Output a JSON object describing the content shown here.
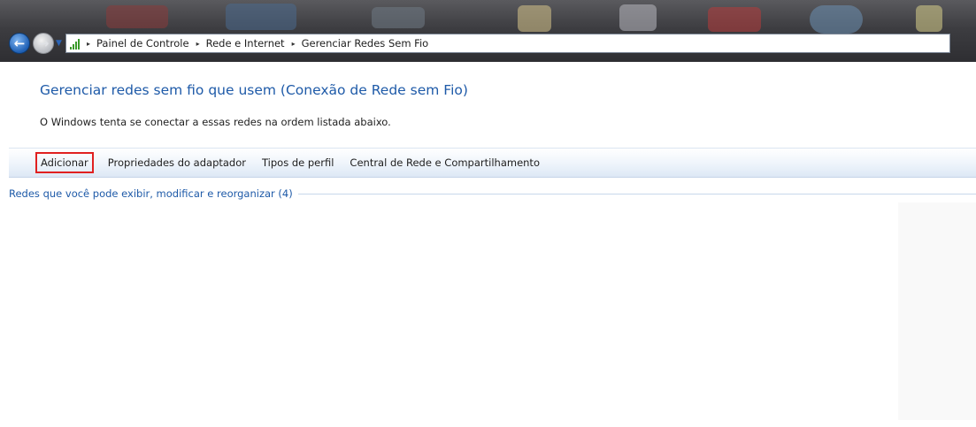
{
  "address_bar": {
    "breadcrumbs": [
      "Painel de Controle",
      "Rede e Internet",
      "Gerenciar Redes Sem Fio"
    ],
    "separator": "▸"
  },
  "nav": {
    "back_icon": "←",
    "forward_icon": "→",
    "dropdown_icon": "▼"
  },
  "page": {
    "title": "Gerenciar redes sem fio que usem (Conexão de Rede sem Fio)",
    "description": "O Windows tenta se conectar a essas redes na ordem listada abaixo."
  },
  "toolbar": {
    "add_label": "Adicionar",
    "adapter_properties_label": "Propriedades do adaptador",
    "profile_types_label": "Tipos de perfil",
    "network_center_label": "Central de Rede e Compartilhamento"
  },
  "networks_group": {
    "label": "Redes que você pode exibir, modificar e reorganizar (4)"
  },
  "colors": {
    "title_blue": "#1e5aa8",
    "highlight_red": "#e02020"
  }
}
